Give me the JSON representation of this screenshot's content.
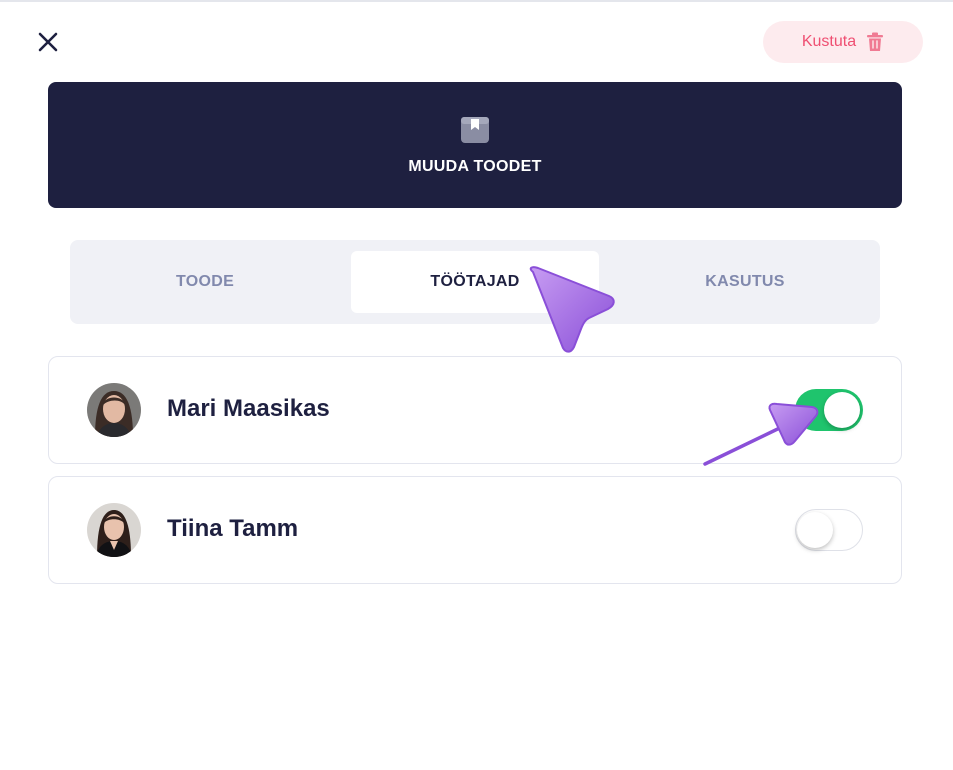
{
  "header": {
    "close_icon": "close-icon",
    "delete_label": "Kustuta",
    "delete_icon": "trash-icon",
    "delete_color": "#ef4f72"
  },
  "hero": {
    "icon": "box-icon",
    "title": "MUUDA TOODET",
    "background": "#1e2040"
  },
  "tabs": [
    {
      "label": "TOODE",
      "active": false
    },
    {
      "label": "TÖÖTAJAD",
      "active": true
    },
    {
      "label": "KASUTUS",
      "active": false
    }
  ],
  "employees": [
    {
      "name": "Mari Maasikas",
      "enabled": true
    },
    {
      "name": "Tiina Tamm",
      "enabled": false
    }
  ],
  "colors": {
    "toggle_on": "#1fc46d",
    "accent_pointer": "#9b5de5"
  }
}
